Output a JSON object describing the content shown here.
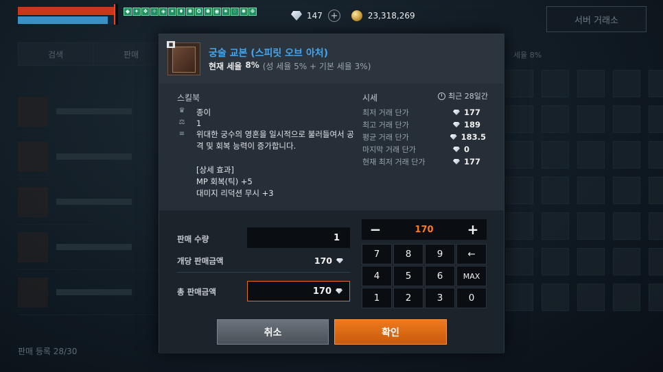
{
  "hud": {
    "hp_fraction": 0.98,
    "mp_fraction": 0.9,
    "buff_icons": [
      "buff-icon",
      "buff-icon",
      "buff-icon",
      "buff-icon",
      "buff-icon",
      "buff-icon",
      "buff-icon",
      "buff-icon",
      "buff-icon",
      "buff-icon",
      "buff-icon",
      "buff-icon",
      "buff-icon",
      "buff-icon",
      "buff-icon"
    ],
    "diamonds": "147",
    "gold": "23,318,269"
  },
  "background": {
    "exchange_button": "서버 거래소",
    "tab_search": "검색",
    "tab_sell": "판매",
    "tax_text": "세율 8%",
    "sell_count": "판매 등록 28/30"
  },
  "item": {
    "name": "궁술 교본 (스피릿 오브 아처)",
    "tax_label": "현재 세율",
    "tax_value": "8%",
    "tax_detail": "(성 세율 5% + 기본 세율 3%)",
    "badge": "■"
  },
  "details": {
    "category": "스킬북",
    "grade": "종이",
    "weight": "1",
    "description": "위대한 궁수의 영혼을 일시적으로 불러들여서 공격 및 회복 능력이 증가합니다.",
    "effect_title": "[상세 효과]",
    "effects": [
      "MP 회복(틱) +5",
      "대미지 리덕션 무시 +3"
    ]
  },
  "market": {
    "title": "시세",
    "period": "최근 28일간",
    "rows": [
      {
        "label": "최저 거래 단가",
        "value": "177"
      },
      {
        "label": "최고 거래 단가",
        "value": "189"
      },
      {
        "label": "평균 거래 단가",
        "value": "183.5"
      },
      {
        "label": "마지막 거래 단가",
        "value": "0"
      },
      {
        "label": "현재 최저 거래 단가",
        "value": "177"
      }
    ]
  },
  "sell": {
    "qty_label": "판매 수량",
    "qty_value": "1",
    "unit_label": "개당 판매금액",
    "unit_value": "170",
    "total_label": "총 판매금액",
    "total_value": "170"
  },
  "pad": {
    "minus": "−",
    "value": "170",
    "plus": "+",
    "keys": [
      "7",
      "8",
      "9",
      "←",
      "4",
      "5",
      "6",
      "MAX",
      "1",
      "2",
      "3",
      "0"
    ]
  },
  "buttons": {
    "cancel": "취소",
    "confirm": "확인"
  },
  "colors": {
    "accent_orange": "#e8741a",
    "title_blue": "#43a6ef"
  }
}
